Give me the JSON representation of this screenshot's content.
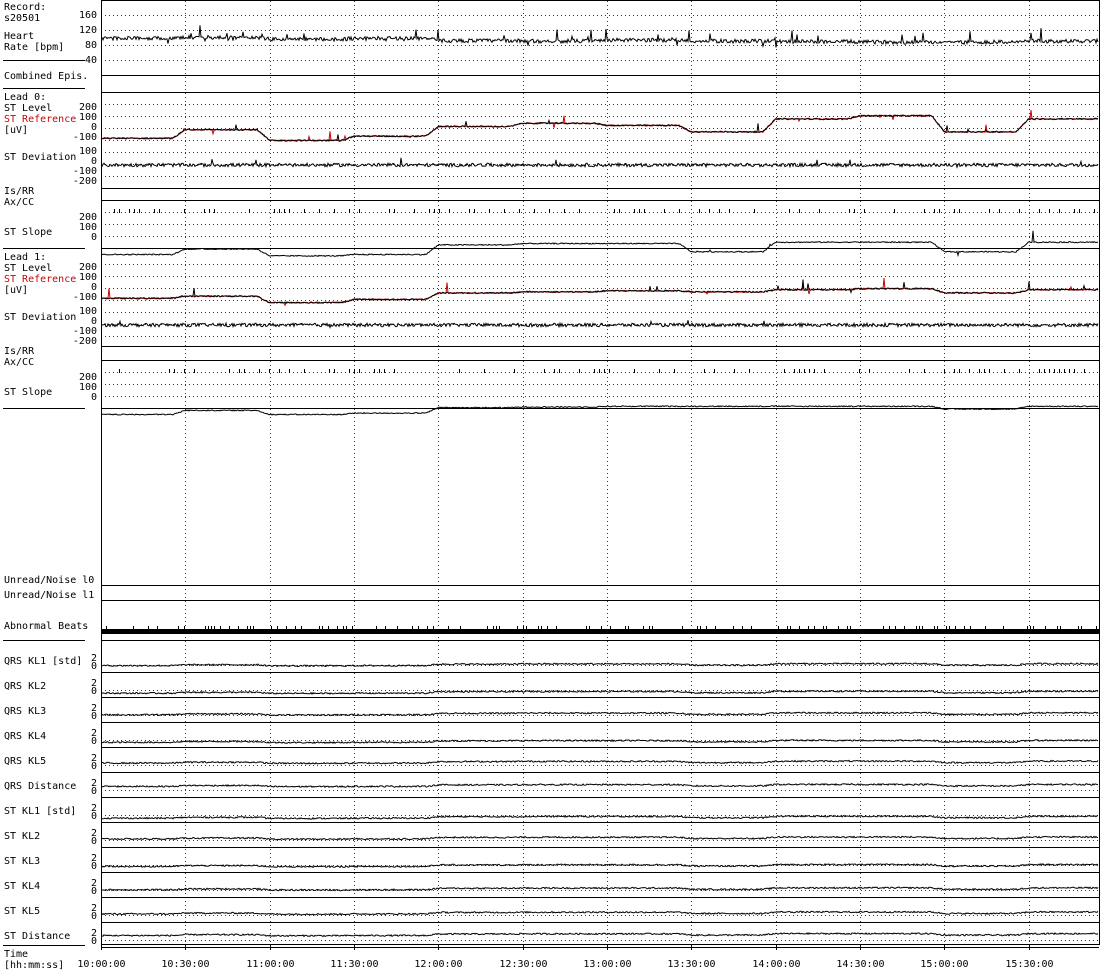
{
  "record": {
    "label": "Record:",
    "id": "s20501"
  },
  "colors": {
    "trace": "#000000",
    "reference": "#cc0000",
    "grid": "#000000"
  },
  "time_axis": {
    "label_line1": "Time",
    "label_line2": "[hh:mm:ss]",
    "start_minutes": 600,
    "end_minutes": 955,
    "ticks": [
      "10:00:00",
      "10:30:00",
      "11:00:00",
      "11:30:00",
      "12:00:00",
      "12:30:00",
      "13:00:00",
      "13:30:00",
      "14:00:00",
      "14:30:00",
      "15:00:00",
      "15:30:00"
    ]
  },
  "panels": {
    "heart_rate": {
      "label1": "Heart",
      "label2": "Rate [bpm]",
      "ticks": [
        "160",
        "120",
        "80",
        "40"
      ]
    },
    "combined": {
      "label": "Combined Epis."
    },
    "lead0": {
      "title": "Lead 0:",
      "st_level": "ST Level",
      "st_reference": "ST Reference",
      "unit": "[uV]",
      "level_ticks": [
        "200",
        "100",
        "0",
        "-100"
      ],
      "st_deviation": "ST Deviation",
      "deviation_ticks": [
        "100",
        "0",
        "-100",
        "-200"
      ],
      "is_rr": "Is/RR",
      "ax_cc": "Ax/CC",
      "st_slope": "ST Slope",
      "slope_ticks": [
        "200",
        "100",
        "0"
      ]
    },
    "lead1": {
      "title": "Lead 1:",
      "st_level": "ST Level",
      "st_reference": "ST Reference",
      "unit": "[uV]",
      "level_ticks": [
        "200",
        "100",
        "0",
        "-100"
      ],
      "st_deviation": "ST Deviation",
      "deviation_ticks": [
        "100",
        "0",
        "-100",
        "-200"
      ],
      "is_rr": "Is/RR",
      "ax_cc": "Ax/CC",
      "st_slope": "ST Slope",
      "slope_ticks": [
        "200",
        "100",
        "0"
      ]
    },
    "unread0": {
      "label": "Unread/Noise l0"
    },
    "unread1": {
      "label": "Unread/Noise l1"
    },
    "abnormal": {
      "label": "Abnormal Beats"
    },
    "kl": [
      {
        "label": "QRS KL1 [std]",
        "ticks": [
          "2",
          "0"
        ]
      },
      {
        "label": "QRS KL2",
        "ticks": [
          "2",
          "0"
        ]
      },
      {
        "label": "QRS KL3",
        "ticks": [
          "2",
          "0"
        ]
      },
      {
        "label": "QRS KL4",
        "ticks": [
          "2",
          "0"
        ]
      },
      {
        "label": "QRS KL5",
        "ticks": [
          "2",
          "0"
        ]
      },
      {
        "label": "QRS Distance",
        "ticks": [
          "2",
          "0"
        ]
      },
      {
        "label": "ST KL1 [std]",
        "ticks": [
          "2",
          "0"
        ]
      },
      {
        "label": "ST KL2",
        "ticks": [
          "2",
          "0"
        ]
      },
      {
        "label": "ST KL3",
        "ticks": [
          "2",
          "0"
        ]
      },
      {
        "label": "ST KL4",
        "ticks": [
          "2",
          "0"
        ]
      },
      {
        "label": "ST KL5",
        "ticks": [
          "2",
          "0"
        ]
      },
      {
        "label": "ST Distance",
        "ticks": [
          "2",
          "0"
        ]
      }
    ]
  },
  "chart_data": {
    "type": "line",
    "x_unit": "hh:mm:ss",
    "x": [
      "10:00:00",
      "10:30:00",
      "11:00:00",
      "11:30:00",
      "12:00:00",
      "12:30:00",
      "13:00:00",
      "13:30:00",
      "14:00:00",
      "14:30:00",
      "15:00:00",
      "15:30:00"
    ],
    "heart_rate_bpm": {
      "ylim": [
        40,
        160
      ],
      "values": [
        90,
        92,
        88,
        90,
        85,
        84,
        86,
        84,
        83,
        82,
        82,
        84
      ]
    },
    "lead0_st_level_uV": {
      "ylim": [
        -150,
        250
      ],
      "values": [
        -60,
        20,
        -80,
        -40,
        50,
        80,
        60,
        0,
        120,
        150,
        0,
        120
      ]
    },
    "lead0_st_reference_uV": {
      "ylim": [
        -150,
        250
      ],
      "values": [
        -60,
        20,
        -80,
        -40,
        50,
        80,
        60,
        0,
        120,
        150,
        0,
        120
      ]
    },
    "lead0_st_slope": {
      "ylim": [
        -100,
        250
      ],
      "values": [
        -60,
        -20,
        -70,
        -60,
        10,
        20,
        20,
        -40,
        30,
        30,
        -40,
        30
      ]
    },
    "lead1_st_level_uV": {
      "ylim": [
        -150,
        250
      ],
      "values": [
        -60,
        -40,
        -100,
        -70,
        -10,
        0,
        10,
        0,
        20,
        30,
        -10,
        20
      ]
    },
    "lead1_st_reference_uV": {
      "ylim": [
        -150,
        250
      ],
      "values": [
        -60,
        -40,
        -100,
        -70,
        -10,
        0,
        10,
        0,
        20,
        30,
        -10,
        20
      ]
    },
    "lead1_st_slope": {
      "ylim": [
        -100,
        250
      ],
      "values": [
        -60,
        -30,
        -60,
        -50,
        -10,
        -5,
        0,
        0,
        0,
        0,
        -20,
        0
      ]
    }
  }
}
